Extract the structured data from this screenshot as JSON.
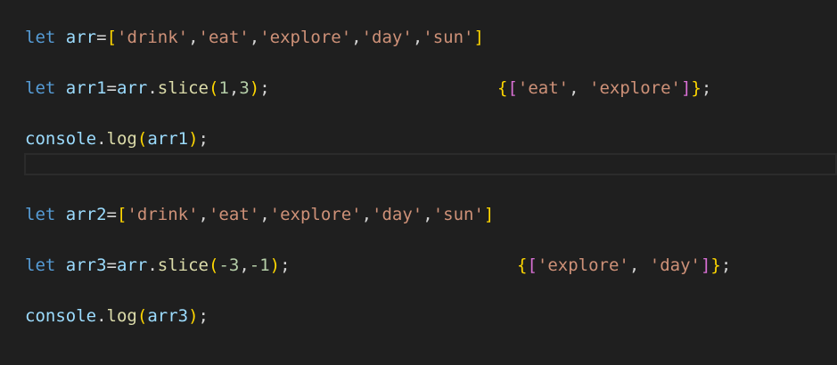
{
  "editor": {
    "lines": [
      {
        "id": "line1",
        "tokens": [
          {
            "t": "let",
            "c": "kw"
          },
          {
            "t": " ",
            "c": "op"
          },
          {
            "t": "arr",
            "c": "var"
          },
          {
            "t": "=",
            "c": "op"
          },
          {
            "t": "[",
            "c": "br1"
          },
          {
            "t": "'drink'",
            "c": "str"
          },
          {
            "t": ",",
            "c": "op"
          },
          {
            "t": "'eat'",
            "c": "str"
          },
          {
            "t": ",",
            "c": "op"
          },
          {
            "t": "'explore'",
            "c": "str"
          },
          {
            "t": ",",
            "c": "op"
          },
          {
            "t": "'day'",
            "c": "str"
          },
          {
            "t": ",",
            "c": "op"
          },
          {
            "t": "'sun'",
            "c": "str"
          },
          {
            "t": "]",
            "c": "br1"
          }
        ]
      },
      {
        "id": "line2",
        "tokens": [
          {
            "t": "let",
            "c": "kw"
          },
          {
            "t": " ",
            "c": "op"
          },
          {
            "t": "arr1",
            "c": "var"
          },
          {
            "t": "=",
            "c": "op"
          },
          {
            "t": "arr",
            "c": "var"
          },
          {
            "t": ".",
            "c": "op"
          },
          {
            "t": "slice",
            "c": "fn"
          },
          {
            "t": "(",
            "c": "br1"
          },
          {
            "t": "1",
            "c": "num"
          },
          {
            "t": ",",
            "c": "op"
          },
          {
            "t": "3",
            "c": "num"
          },
          {
            "t": ")",
            "c": "br1"
          },
          {
            "t": ";",
            "c": "op"
          }
        ]
      },
      {
        "id": "line3",
        "tokens": [
          {
            "t": "console",
            "c": "var"
          },
          {
            "t": ".",
            "c": "op"
          },
          {
            "t": "log",
            "c": "fn"
          },
          {
            "t": "(",
            "c": "br1"
          },
          {
            "t": "arr1",
            "c": "var"
          },
          {
            "t": ")",
            "c": "br1"
          },
          {
            "t": ";",
            "c": "op"
          }
        ]
      },
      {
        "id": "line4",
        "tokens": [
          {
            "t": "let",
            "c": "kw"
          },
          {
            "t": " ",
            "c": "op"
          },
          {
            "t": "arr2",
            "c": "var"
          },
          {
            "t": "=",
            "c": "op"
          },
          {
            "t": "[",
            "c": "br1"
          },
          {
            "t": "'drink'",
            "c": "str"
          },
          {
            "t": ",",
            "c": "op"
          },
          {
            "t": "'eat'",
            "c": "str"
          },
          {
            "t": ",",
            "c": "op"
          },
          {
            "t": "'explore'",
            "c": "str"
          },
          {
            "t": ",",
            "c": "op"
          },
          {
            "t": "'day'",
            "c": "str"
          },
          {
            "t": ",",
            "c": "op"
          },
          {
            "t": "'sun'",
            "c": "str"
          },
          {
            "t": "]",
            "c": "br1"
          }
        ]
      },
      {
        "id": "line5",
        "tokens": [
          {
            "t": "let",
            "c": "kw"
          },
          {
            "t": " ",
            "c": "op"
          },
          {
            "t": "arr3",
            "c": "var"
          },
          {
            "t": "=",
            "c": "op"
          },
          {
            "t": "arr",
            "c": "var"
          },
          {
            "t": ".",
            "c": "op"
          },
          {
            "t": "slice",
            "c": "fn"
          },
          {
            "t": "(",
            "c": "br1"
          },
          {
            "t": "-3",
            "c": "num"
          },
          {
            "t": ",",
            "c": "op"
          },
          {
            "t": "-1",
            "c": "num"
          },
          {
            "t": ")",
            "c": "br1"
          },
          {
            "t": ";",
            "c": "op"
          }
        ]
      },
      {
        "id": "line6",
        "tokens": [
          {
            "t": "console",
            "c": "var"
          },
          {
            "t": ".",
            "c": "op"
          },
          {
            "t": "log",
            "c": "fn"
          },
          {
            "t": "(",
            "c": "br1"
          },
          {
            "t": "arr3",
            "c": "var"
          },
          {
            "t": ")",
            "c": "br1"
          },
          {
            "t": ";",
            "c": "op"
          }
        ]
      }
    ],
    "results": [
      {
        "id": "result1",
        "tokens": [
          {
            "t": "{",
            "c": "br1"
          },
          {
            "t": "[",
            "c": "br2"
          },
          {
            "t": "'eat'",
            "c": "str"
          },
          {
            "t": ", ",
            "c": "op"
          },
          {
            "t": "'explore'",
            "c": "str"
          },
          {
            "t": "]",
            "c": "br2"
          },
          {
            "t": "}",
            "c": "br1"
          },
          {
            "t": ";",
            "c": "op"
          }
        ]
      },
      {
        "id": "result2",
        "tokens": [
          {
            "t": "{",
            "c": "br1"
          },
          {
            "t": "[",
            "c": "br2"
          },
          {
            "t": "'explore'",
            "c": "str"
          },
          {
            "t": ", ",
            "c": "op"
          },
          {
            "t": "'day'",
            "c": "str"
          },
          {
            "t": "]",
            "c": "br2"
          },
          {
            "t": "}",
            "c": "br1"
          },
          {
            "t": ";",
            "c": "op"
          }
        ]
      }
    ]
  },
  "colors": {
    "background": "#1f1f1f",
    "keyword": "#569cd6",
    "variable": "#9cdcfe",
    "function": "#dcdcaa",
    "string": "#ce9178",
    "number": "#b5cea8",
    "bracket_level1": "#ffd700",
    "bracket_level2": "#da70d6"
  }
}
